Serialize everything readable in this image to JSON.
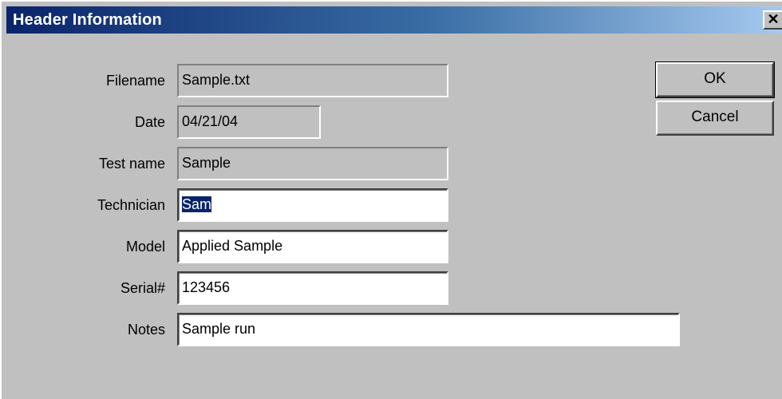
{
  "window": {
    "title": "Header Information",
    "close_glyph": "✕"
  },
  "fields": {
    "filename": {
      "label": "Filename",
      "value": "Sample.txt"
    },
    "date": {
      "label": "Date",
      "value": "04/21/04"
    },
    "test_name": {
      "label": "Test name",
      "value": "Sample"
    },
    "technician": {
      "label": "Technician",
      "value": "Sam"
    },
    "model": {
      "label": "Model",
      "value": "Applied Sample"
    },
    "serial": {
      "label": "Serial#",
      "value": "123456"
    },
    "notes": {
      "label": "Notes",
      "value": "Sample run"
    }
  },
  "buttons": {
    "ok_label": "OK",
    "cancel_label": "Cancel"
  },
  "colors": {
    "titlebar_start": "#0a246a",
    "titlebar_end": "#a6caf0",
    "face": "#c0c0c0",
    "selection": "#0a246a"
  }
}
